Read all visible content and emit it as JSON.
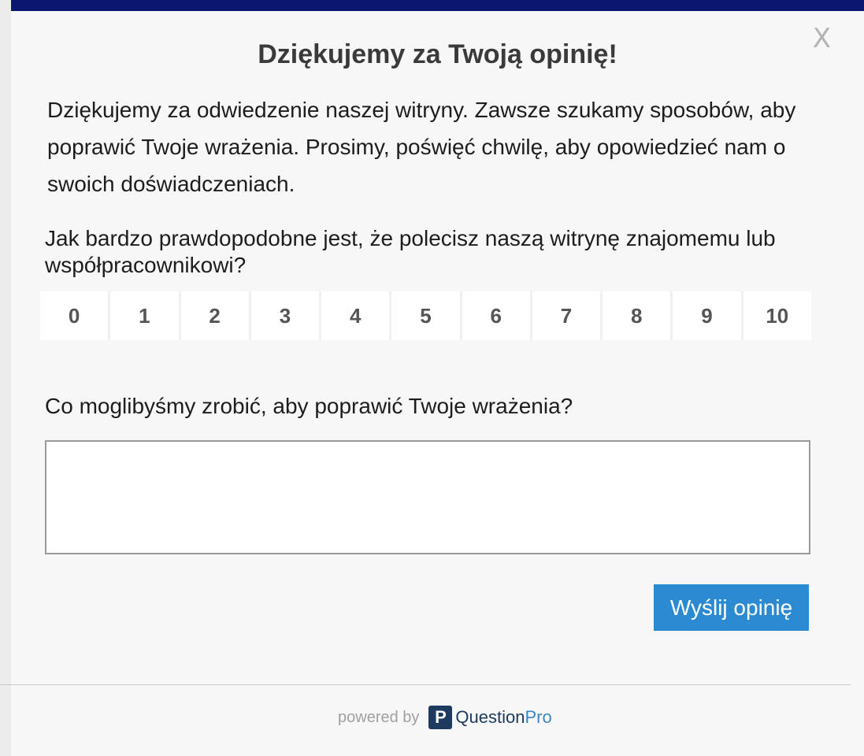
{
  "dialog": {
    "close_label": "X",
    "title": "Dziękujemy za Twoją opinię!",
    "intro": "Dziękujemy za odwiedzenie naszej witryny. Zawsze szukamy sposobów, aby poprawić Twoje wrażenia. Prosimy, poświęć chwilę, aby opowiedzieć nam o swoich doświadczeniach.",
    "question_nps": "Jak bardzo prawdopodobne jest, że polecisz naszą witrynę znajomemu lub współpracownikowi?",
    "scale": [
      "0",
      "1",
      "2",
      "3",
      "4",
      "5",
      "6",
      "7",
      "8",
      "9",
      "10"
    ],
    "question_feedback": "Co moglibyśmy zrobić, aby poprawić Twoje wrażenia?",
    "feedback_value": "",
    "submit_label": "Wyślij opinię"
  },
  "footer": {
    "powered_by": "powered by",
    "logo_letter": "P",
    "brand_question": "Question",
    "brand_pro": "Pro"
  },
  "colors": {
    "top_bar": "#0a1670",
    "submit": "#2b8ad1",
    "brand_dark": "#1e3a5f",
    "brand_light": "#3a86c8"
  }
}
